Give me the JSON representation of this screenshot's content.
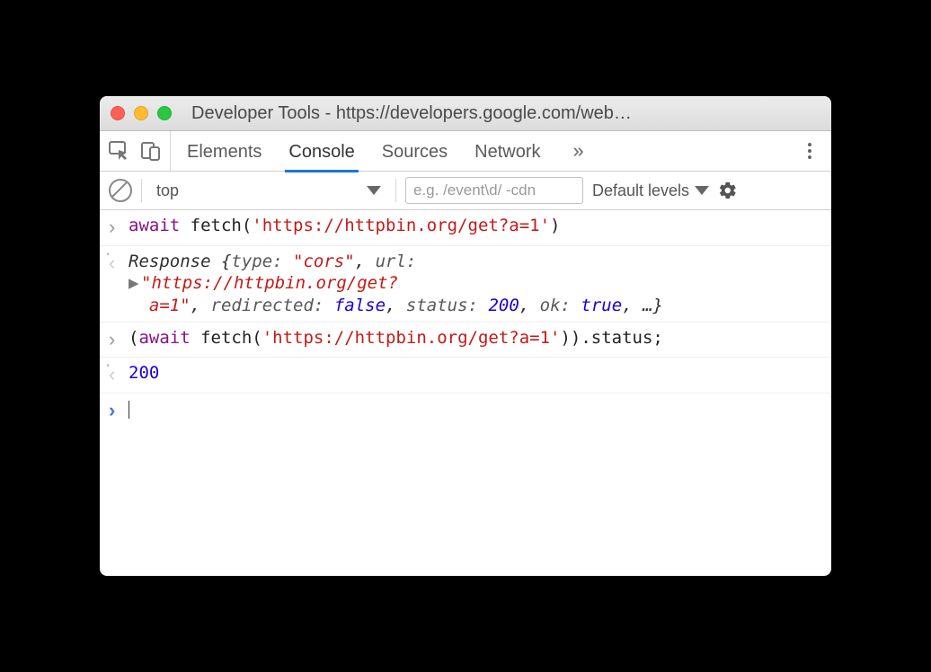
{
  "window": {
    "title": "Developer Tools - https://developers.google.com/web…"
  },
  "tabs": {
    "elements": "Elements",
    "console": "Console",
    "sources": "Sources",
    "network": "Network",
    "more": "»"
  },
  "filter": {
    "context": "top",
    "placeholder": "e.g. /event\\d/ -cdn",
    "levels": "Default levels"
  },
  "lines": {
    "l1": {
      "kw": "await",
      "fn": " fetch(",
      "str": "'https://httpbin.org/get?a=1'",
      "close": ")"
    },
    "l2": {
      "pre": "  Response ",
      "open": "{",
      "p_type": "type: ",
      "v_type": "\"cors\"",
      "c1": ", ",
      "p_url": "url: ",
      "v_url_a": "\"https://httpbin.org/get?",
      "v_url_b": "a=1\"",
      "c2": ", ",
      "p_redir": "redirected: ",
      "v_redir": "false",
      "c3": ", ",
      "p_status": "status: ",
      "v_status": "200",
      "c4": ", ",
      "p_ok": "ok: ",
      "v_ok": "true",
      "c5": ", …}",
      "expander": "▶"
    },
    "l3": {
      "open": "(",
      "kw": "await",
      "fn": " fetch(",
      "str": "'https://httpbin.org/get?a=1'",
      "close": ")).status;"
    },
    "l4": {
      "value": "200"
    }
  }
}
